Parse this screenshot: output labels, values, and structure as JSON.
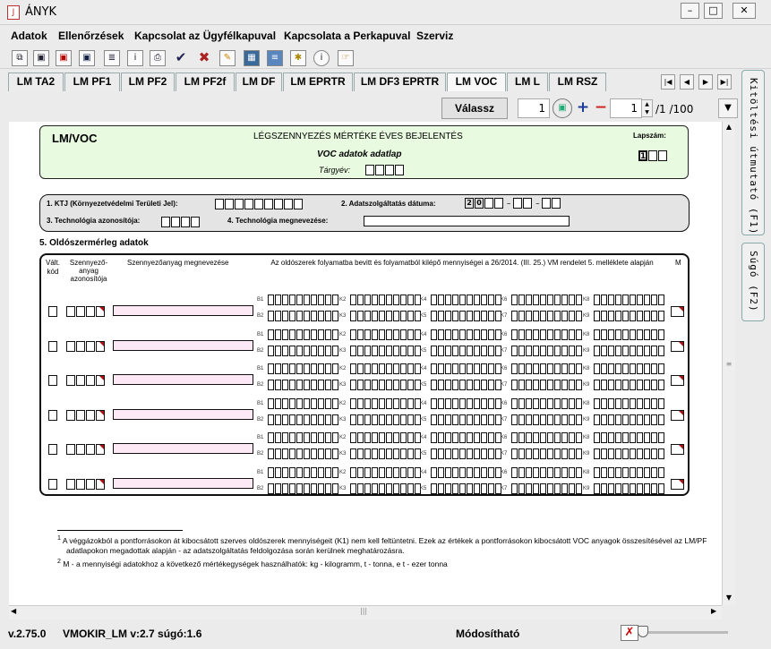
{
  "window": {
    "icon": "java-icon",
    "title": "ÁNYK"
  },
  "menu": [
    "Adatok",
    "Ellenőrzések",
    "Kapcsolat az Ügyfélkapuval",
    "Kapcsolata a Perkapuval",
    "Szerviz"
  ],
  "toolbar_icons": [
    "copy-icon",
    "save-icon",
    "delete-icon",
    "save-as-icon",
    "print-preview-icon",
    "info-icon",
    "print-icon",
    "check-icon",
    "cancel-icon",
    "edit-icon",
    "calculator-icon",
    "book-icon",
    "attachment-icon",
    "help-icon",
    "navigate-icon"
  ],
  "tabs": [
    "LM TA2",
    "LM PF1",
    "LM PF2",
    "LM PF2f",
    "LM DF",
    "LM EPRTR",
    "LM DF3 EPRTR",
    "LM VOC",
    "LM L",
    "LM RSZ"
  ],
  "active_tab": "LM VOC",
  "pager": {
    "button": "Válassz",
    "field1": "1",
    "field2": "1",
    "total": "/1 /100"
  },
  "side_tabs": [
    "Kitöltési útmutató (F1)",
    "Súgó (F2)"
  ],
  "form": {
    "code": "LM/VOC",
    "heading": "LÉGSZENNYEZÉS MÉRTÉKE ÉVES BEJELENTÉS",
    "subheading": "VOC adatok adatlap",
    "targyev_label": "Tárgyév:",
    "lapszam_label": "Lapszám:",
    "lapszam_value": "1",
    "ktj_label": "1. KTJ (Környezetvédelmi Területi Jel):",
    "datum_label": "2. Adatszolgáltatás dátuma:",
    "datum_prefix": [
      "2",
      "0"
    ],
    "tech_id_label": "3. Technológia azonosítója:",
    "tech_name_label": "4. Technológia megnevezése:",
    "section_title": "5. Oldószermérleg adatok",
    "col_valt": "Vált. kód",
    "col_szenny_id": "Szennyező-anyag azonosítója",
    "col_szenny_name": "Szennyezőanyag megnevezése",
    "col_mennyiseg": "Az oldószerek folyamatba bevitt és folyamatból kilépő mennyiségei a 26/2014. (III. 25.) VM rendelet 5. melléklete alapján",
    "col_m": "M",
    "row_labels": [
      [
        "B1",
        "K2",
        "K4",
        "K6",
        "K8"
      ],
      [
        "B2",
        "K3",
        "K5",
        "K7",
        "K9"
      ]
    ],
    "row_count": 6,
    "footnote1": "A véggázokból a pontforrásokon át kibocsátott szerves oldószerek mennyiségeit (K1) nem kell feltüntetni. Ezek az értékek a pontforrásokon kibocsátott VOC anyagok összesítésével az LM/PF adatlapokon megadottak alapján - az adatszolgáltatás feldolgozása során kerülnek meghatározásra.",
    "footnote2": "M - a mennyiségi adatokhoz a következő mértékegységek használhatók: kg - kilogramm, t - tonna, e t - ezer tonna"
  },
  "status": {
    "version": "v.2.75.0",
    "module": "VMOKIR_LM v:2.7 súgó:1.6",
    "state": "Módosítható"
  }
}
